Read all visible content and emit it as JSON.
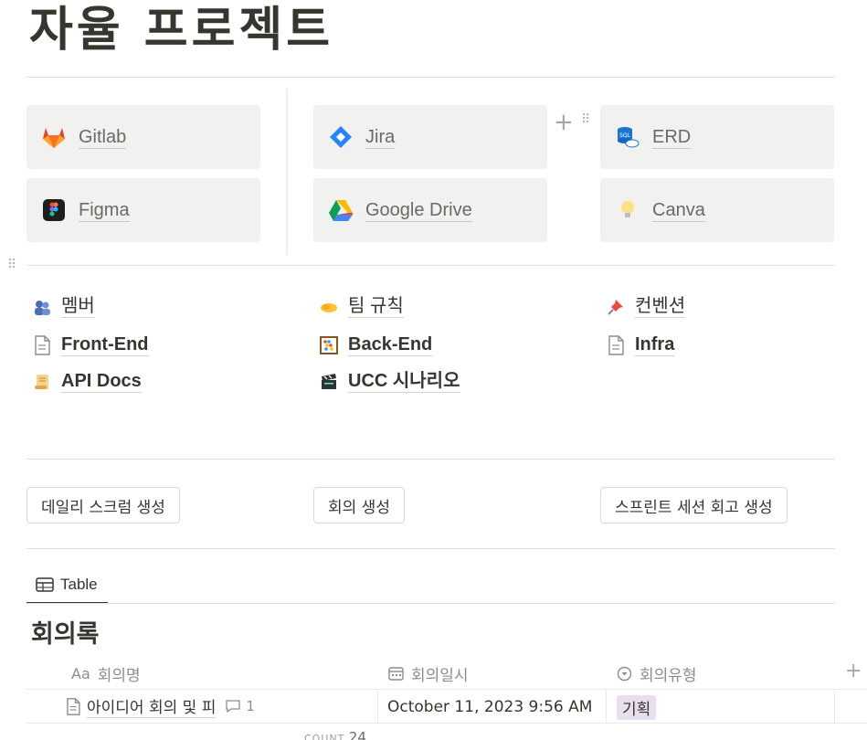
{
  "page": {
    "title": "자율 프로젝트"
  },
  "links": [
    {
      "label": "Gitlab",
      "icon": "gitlab-icon"
    },
    {
      "label": "Figma",
      "icon": "figma-icon"
    },
    {
      "label": "Jira",
      "icon": "jira-icon"
    },
    {
      "label": "Google Drive",
      "icon": "google-drive-icon"
    },
    {
      "label": "ERD",
      "icon": "sql-database-icon"
    },
    {
      "label": "Canva",
      "icon": "lightbulb-icon"
    }
  ],
  "pages": [
    {
      "label": "멤버",
      "icon": "people-icon"
    },
    {
      "label": "Front-End",
      "icon": "document-icon"
    },
    {
      "label": "API Docs",
      "icon": "scroll-icon"
    },
    {
      "label": "팀 규칙",
      "icon": "handshake-icon"
    },
    {
      "label": "Back-End",
      "icon": "abacus-icon"
    },
    {
      "label": "UCC 시나리오",
      "icon": "clapperboard-icon"
    },
    {
      "label": "컨벤션",
      "icon": "pushpin-icon"
    },
    {
      "label": "Infra",
      "icon": "document-icon"
    }
  ],
  "buttons": {
    "daily_scrum": "데일리 스크럼 생성",
    "meeting": "회의 생성",
    "sprint_retro": "스프린트 세션 회고 생성"
  },
  "database": {
    "view_tab": "Table",
    "title": "회의록",
    "columns": [
      {
        "label": "회의명",
        "icon_text": "Aa"
      },
      {
        "label": "회의일시",
        "icon": "calendar-icon"
      },
      {
        "label": "회의유형",
        "icon": "select-icon"
      }
    ],
    "rows": [
      {
        "name": "아이디어 회의 및 피",
        "comments": "1",
        "date": "October 11, 2023 9:56 AM",
        "type": "기획"
      }
    ],
    "count_label": "COUNT",
    "count_value": "24"
  },
  "colors": {
    "tag_purple": "#e8deee",
    "card_bg": "#f1f1ef",
    "text": "#37352f"
  }
}
